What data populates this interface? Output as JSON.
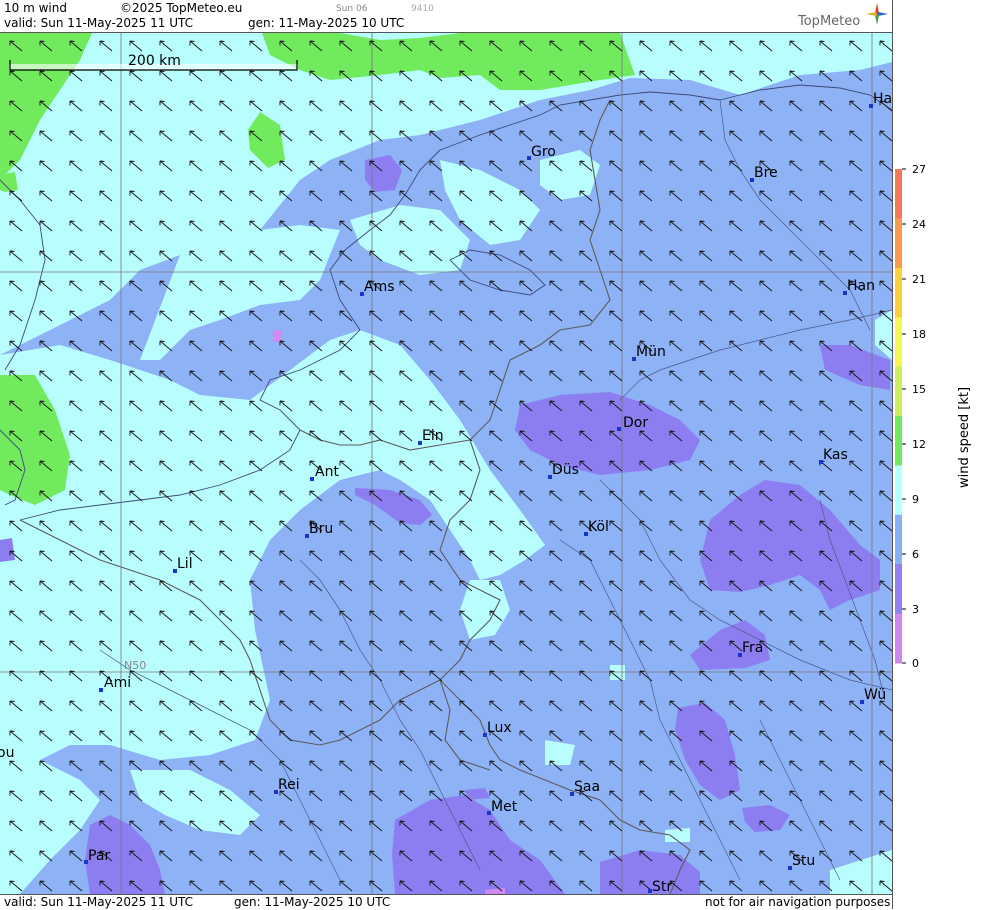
{
  "header": {
    "product": "10 m wind",
    "copyright": "©2025 TopMeteo.eu",
    "run_code": "Sun 06",
    "code2": "9410",
    "valid": "valid:  Sun  11-May-2025  11 UTC",
    "generated": "gen: 11-May-2025 10 UTC",
    "logo": "TopMeteo"
  },
  "footer": {
    "valid": "valid:  Sun  11-May-2025  11 UTC",
    "generated": "gen: 11-May-2025 10 UTC",
    "disclaimer": "not for air navigation purposes"
  },
  "scale": {
    "label": "200 km"
  },
  "grid": {
    "lat_label": "N50"
  },
  "colorbar": {
    "title": "wind  speed  [kt]",
    "ticks": [
      "27",
      "24",
      "21",
      "18",
      "15",
      "12",
      "9",
      "6",
      "3",
      "0"
    ],
    "colors": [
      "#f07a5a",
      "#f59a50",
      "#fbd03c",
      "#f6f654",
      "#c8f060",
      "#70e860",
      "#b4ffff",
      "#88b0f8",
      "#9080f0",
      "#cc88f0"
    ]
  },
  "cities": [
    {
      "name": "Gro"
    },
    {
      "name": "Bre"
    },
    {
      "name": "Ha"
    },
    {
      "name": "Ams"
    },
    {
      "name": "Han"
    },
    {
      "name": "Mün"
    },
    {
      "name": "Dor"
    },
    {
      "name": "Ein"
    },
    {
      "name": "Kas"
    },
    {
      "name": "Ant"
    },
    {
      "name": "Düs"
    },
    {
      "name": "Bru"
    },
    {
      "name": "Köl"
    },
    {
      "name": "Lil"
    },
    {
      "name": "Fra"
    },
    {
      "name": "Ami"
    },
    {
      "name": "Wü"
    },
    {
      "name": "Lux"
    },
    {
      "name": "ou"
    },
    {
      "name": "Rei"
    },
    {
      "name": "Saa"
    },
    {
      "name": "Met"
    },
    {
      "name": "Par"
    },
    {
      "name": "Stu"
    },
    {
      "name": "Str"
    }
  ],
  "colors": {
    "base": "#8eb2f6",
    "cyan": "#b8fefe",
    "green": "#72ea5e",
    "purple": "#8c7ef0",
    "violet": "#d08af0"
  }
}
